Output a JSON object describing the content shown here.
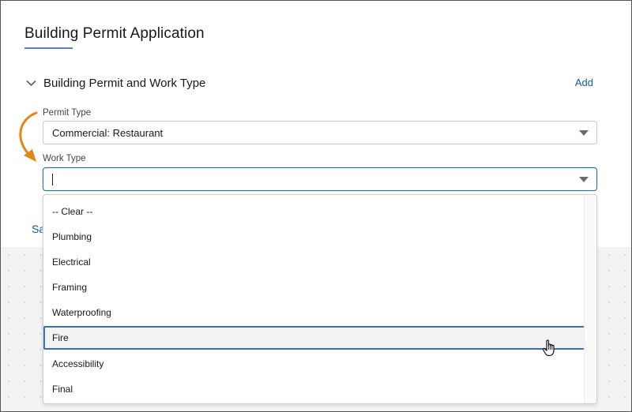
{
  "page": {
    "title": "Building Permit Application"
  },
  "section": {
    "title": "Building Permit and Work Type",
    "add_label": "Add"
  },
  "permit_type": {
    "label": "Permit Type",
    "value": "Commercial: Restaurant"
  },
  "work_type": {
    "label": "Work Type",
    "value": ""
  },
  "partial_link": {
    "text": "Sa"
  },
  "dropdown": {
    "options": [
      "-- Clear --",
      "Plumbing",
      "Electrical",
      "Framing",
      "Waterproofing",
      "Fire",
      "Accessibility",
      "Final"
    ],
    "highlighted": "Fire"
  },
  "icons": {
    "collapse": "chevron-down-icon",
    "select_caret": "caret-down-icon",
    "annotation_arrow": "curved-arrow-icon",
    "pointer": "hand-pointer-icon"
  },
  "colors": {
    "link": "#0b5cab",
    "focus_border": "#2574a9",
    "highlight_border": "#3c70b8",
    "annotation_arrow": "#e0861a",
    "title_underline": "#5b7fc7"
  }
}
